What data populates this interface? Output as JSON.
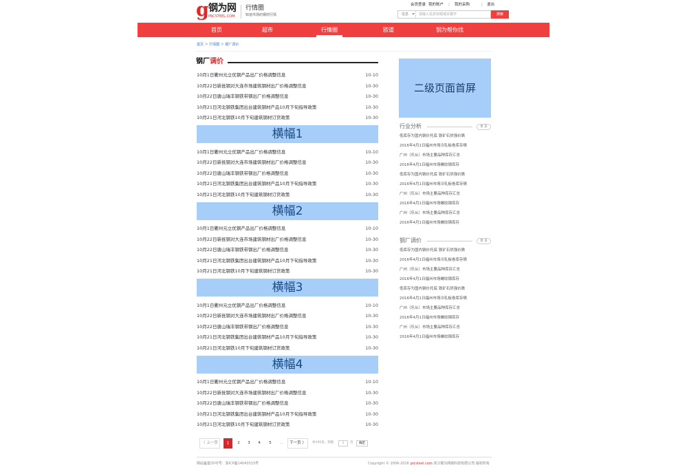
{
  "header": {
    "logo_mark": "g",
    "logo_text": "钢为网",
    "logo_sub": "PRCSTEEL.COM",
    "section_title": "行情圈",
    "section_subtitle": "知道市场的钢材行情",
    "top_links": [
      "会员登录",
      "我的账户",
      "我的采购",
      "退出"
    ],
    "search_select": "信息",
    "search_placeholder": "请输入信息标题或关键字",
    "search_button": "搜索"
  },
  "nav": {
    "items": [
      "首页",
      "超市",
      "行情圈",
      "欧道",
      "钢为帮你找"
    ],
    "active_index": 2
  },
  "breadcrumb": "首页 ＞ 行情圈 ＞ 钢厂调价",
  "main": {
    "title_black": "钢厂",
    "title_red": "调价",
    "groups": [
      {
        "rows": [
          {
            "text": "10月1日衢州元立优钢产品出厂价格调整信息",
            "date": "10-10"
          },
          {
            "text": "10月22日新抚钢对大连市场建筑钢材出厂价格调整信息",
            "date": "10-30"
          },
          {
            "text": "10月22日唐山瑞丰钢铁带钢出厂价格调整信息",
            "date": "10-30"
          },
          {
            "text": "10月21日河北钢铁集团出台建筑钢材产品10月下旬指导政策",
            "date": "10-30"
          },
          {
            "text": "10月21日河北钢铁10月下旬建筑钢材订货政策",
            "date": "10-30"
          }
        ],
        "banner": "横幅1"
      },
      {
        "rows": [
          {
            "text": "10月1日衢州元立优钢产品出厂价格调整信息",
            "date": "10-10"
          },
          {
            "text": "10月22日新抚钢对大连市场建筑钢材出厂价格调整信息",
            "date": "10-30"
          },
          {
            "text": "10月22日唐山瑞丰钢铁带钢出厂价格调整信息",
            "date": "10-30"
          },
          {
            "text": "10月21日河北钢铁集团出台建筑钢材产品10月下旬指导政策",
            "date": "10-30"
          },
          {
            "text": "10月21日河北钢铁10月下旬建筑钢材订货政策",
            "date": "10-30"
          }
        ],
        "banner": "横幅2"
      },
      {
        "rows": [
          {
            "text": "10月1日衢州元立优钢产品出厂价格调整信息",
            "date": "10-10"
          },
          {
            "text": "10月22日新抚钢对大连市场建筑钢材出厂价格调整信息",
            "date": "10-30"
          },
          {
            "text": "10月22日唐山瑞丰钢铁带钢出厂价格调整信息",
            "date": "10-30"
          },
          {
            "text": "10月21日河北钢铁集团出台建筑钢材产品10月下旬指导政策",
            "date": "10-30"
          },
          {
            "text": "10月21日河北钢铁10月下旬建筑钢材订货政策",
            "date": "10-30"
          }
        ],
        "banner": "横幅3"
      },
      {
        "rows": [
          {
            "text": "10月1日衢州元立优钢产品出厂价格调整信息",
            "date": "10-10"
          },
          {
            "text": "10月22日新抚钢对大连市场建筑钢材出厂价格调整信息",
            "date": "10-30"
          },
          {
            "text": "10月22日唐山瑞丰钢铁带钢出厂价格调整信息",
            "date": "10-30"
          },
          {
            "text": "10月21日河北钢铁集团出台建筑钢材产品10月下旬指导政策",
            "date": "10-30"
          },
          {
            "text": "10月21日河北钢铁10月下旬建筑钢材订货政策",
            "date": "10-30"
          }
        ],
        "banner": "横幅4"
      },
      {
        "rows": [
          {
            "text": "10月1日衢州元立优钢产品出厂价格调整信息",
            "date": "10-10"
          },
          {
            "text": "10月22日新抚钢对大连市场建筑钢材出厂价格调整信息",
            "date": "10-30"
          },
          {
            "text": "10月22日唐山瑞丰钢铁带钢出厂价格调整信息",
            "date": "10-30"
          },
          {
            "text": "10月21日河北钢铁集团出台建筑钢材产品10月下旬指导政策",
            "date": "10-30"
          },
          {
            "text": "10月21日河北钢铁10月下旬建筑钢材订货政策",
            "date": "10-30"
          }
        ],
        "banner": null
      }
    ]
  },
  "sidebar": {
    "ad_text": "二级页面首屏",
    "sections": [
      {
        "title": "行业分析",
        "more": "更 多",
        "items": [
          "低库存为国内钢价托底 铁矿石供强价跌",
          "2016年4月1日福州市场冷轧板卷库存情",
          "广州（乐从）市场主要品种库存汇总",
          "2016年4月1日福州市场螺纹钢库存",
          "低库存为国内钢价托底 铁矿石供强价跌",
          "2016年4月1日福州市场冷轧板卷库存情",
          "广州（乐从）市场主要品种库存汇总",
          "2016年4月1日福州市场螺纹钢库存",
          "广州（乐从）市场主要品种库存汇总",
          "2016年4月1日福州市场螺纹钢库存"
        ]
      },
      {
        "title": "钢厂调价",
        "more": "更 多",
        "items": [
          "低库存为国内钢价托底 铁矿石供强价跌",
          "2016年4月1日福州市场冷轧板卷库存情",
          "广州（乐从）市场主要品种库存汇总",
          "2016年4月1日福州市场螺纹钢库存",
          "低库存为国内钢价托底 铁矿石供强价跌",
          "2016年4月1日福州市场冷轧板卷库存情",
          "广州（乐从）市场主要品种库存汇总",
          "2016年4月1日福州市场螺纹钢库存",
          "广州（乐从）市场主要品种库存汇总",
          "2016年4月1日福州市场螺纹钢库存"
        ]
      }
    ]
  },
  "pagination": {
    "prev": "〈 上一页",
    "pages": [
      "1",
      "2",
      "3",
      "4",
      "5"
    ],
    "current": "1",
    "ellipsis": "…",
    "next": "下一页 〉",
    "total_text": "共100页，到第",
    "goto_value": "1",
    "page_unit": "页",
    "confirm": "确定"
  },
  "footer": {
    "icp": "网站备案/许可号：浙ICP备14043533号",
    "copyright_prefix": "Copyright © 2006-2016 ",
    "copyright_site": "prcsteel.com",
    "copyright_suffix": " 浙江钢为网络科技有限公司 版权所有"
  }
}
